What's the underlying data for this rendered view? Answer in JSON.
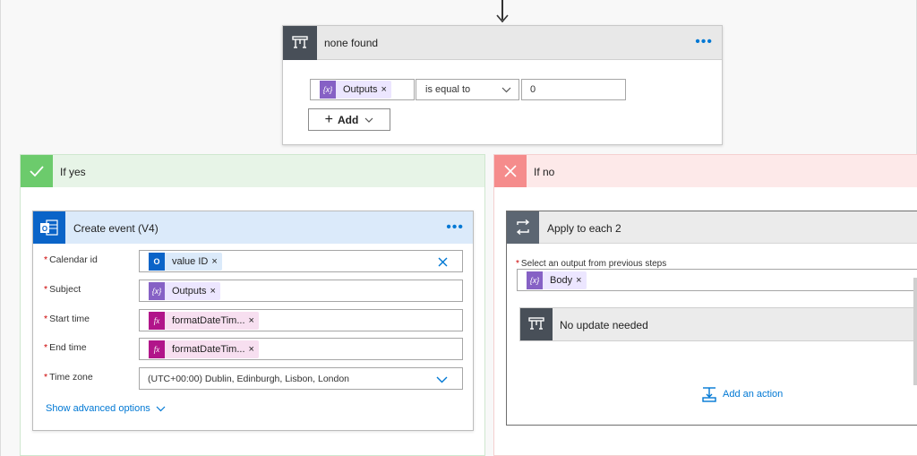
{
  "condition": {
    "title": "none found",
    "more_icon": "ellipsis-icon",
    "left_token": "Outputs",
    "operator": "is equal to",
    "right_value": "0",
    "add_label": "Add"
  },
  "branch_yes": {
    "title": "If yes",
    "color": "#6ccb6c"
  },
  "branch_no": {
    "title": "If no",
    "color": "#f58c8c"
  },
  "create_event": {
    "title": "Create event (V4)",
    "fields": {
      "calendar_label": "Calendar id",
      "calendar_token": "value ID",
      "subject_label": "Subject",
      "subject_token": "Outputs",
      "start_label": "Start time",
      "start_token": "formatDateTim...",
      "end_label": "End time",
      "end_token": "formatDateTim...",
      "timezone_label": "Time zone",
      "timezone_value": "(UTC+00:00) Dublin, Edinburgh, Lisbon, London"
    },
    "show_advanced": "Show advanced options"
  },
  "apply_each": {
    "title": "Apply to each 2",
    "select_label": "Select an output from previous steps",
    "token": "Body"
  },
  "no_update": {
    "title": "No update needed"
  },
  "add_action": "Add an action",
  "colors": {
    "accent": "#0078d4",
    "variable_token": "#8661c5",
    "expression_token": "#b1158a",
    "outlook": "#0a64c8"
  }
}
